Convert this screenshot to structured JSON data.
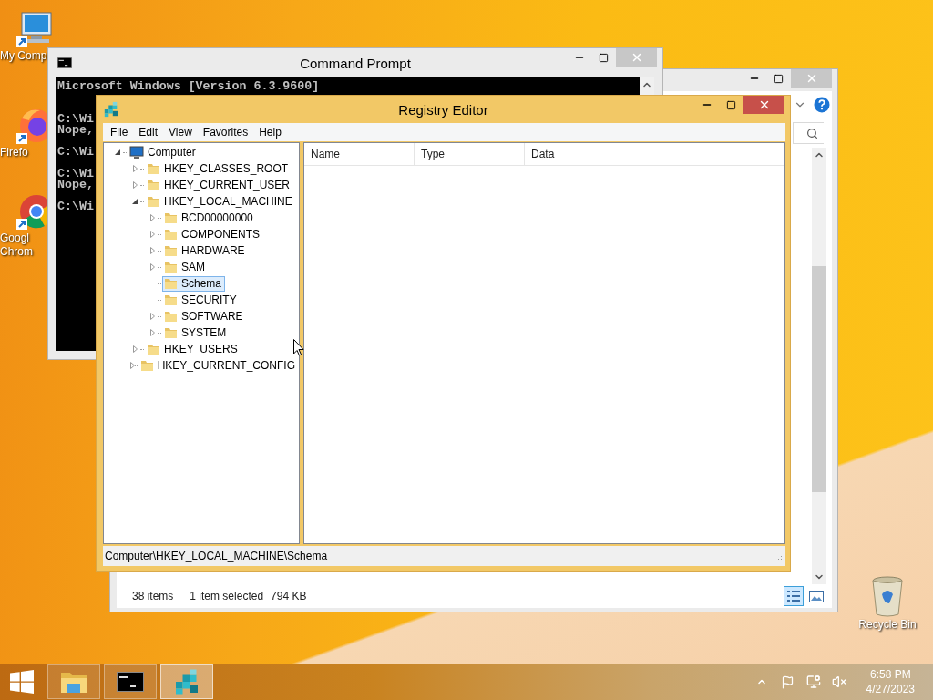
{
  "desktop": {
    "icons": [
      {
        "kind": "computer",
        "lines": [
          "My Comp"
        ]
      },
      {
        "kind": "firefox",
        "lines": [
          "Firefo"
        ]
      },
      {
        "kind": "chrome",
        "lines": [
          "Googl",
          "Chrom"
        ]
      },
      {
        "kind": "recycle",
        "lines": [
          "Recycle Bin"
        ]
      }
    ]
  },
  "command_prompt": {
    "title": "Command Prompt",
    "blocks": [
      [
        "Microsoft Windows [Version 6.3.9600]"
      ],
      [
        "C:\\Wi",
        "Nope,"
      ],
      [
        "C:\\Wi"
      ],
      [
        "C:\\Wi",
        "Nope,"
      ],
      [
        "C:\\Wi"
      ]
    ]
  },
  "explorer": {
    "status_bar": {
      "items": "38 items",
      "selection": "1 item selected",
      "size": "794 KB"
    },
    "views": [
      {
        "kind": "details",
        "selected": true
      },
      {
        "kind": "large",
        "selected": false
      }
    ]
  },
  "registry_editor": {
    "title": "Registry Editor",
    "menu": [
      "File",
      "Edit",
      "View",
      "Favorites",
      "Help"
    ],
    "tree": {
      "label": "Computer",
      "kind": "computer",
      "expanded": true,
      "selected": false,
      "children": [
        {
          "label": "HKEY_CLASSES_ROOT",
          "expanded": false,
          "selected": false
        },
        {
          "label": "HKEY_CURRENT_USER",
          "expanded": false,
          "selected": false
        },
        {
          "label": "HKEY_LOCAL_MACHINE",
          "expanded": true,
          "selected": false,
          "children": [
            {
              "label": "BCD00000000",
              "expanded": false,
              "selected": false
            },
            {
              "label": "COMPONENTS",
              "expanded": false,
              "selected": false
            },
            {
              "label": "HARDWARE",
              "expanded": false,
              "selected": false
            },
            {
              "label": "SAM",
              "expanded": false,
              "selected": false
            },
            {
              "label": "Schema",
              "selected": true
            },
            {
              "label": "SECURITY",
              "selected": false
            },
            {
              "label": "SOFTWARE",
              "expanded": false,
              "selected": false
            },
            {
              "label": "SYSTEM",
              "expanded": false,
              "selected": false
            }
          ]
        },
        {
          "label": "HKEY_USERS",
          "expanded": false,
          "selected": false
        },
        {
          "label": "HKEY_CURRENT_CONFIG",
          "expanded": false,
          "selected": false
        }
      ]
    },
    "columns": [
      "Name",
      "Type",
      "Data"
    ],
    "status_bar": "Computer\\HKEY_LOCAL_MACHINE\\Schema"
  },
  "taskbar": {
    "apps": [
      {
        "kind": "explorer",
        "selected": false
      },
      {
        "kind": "console",
        "selected": false
      },
      {
        "kind": "registry",
        "selected": true
      }
    ],
    "volume_muted": true,
    "time": "6:58 PM",
    "date": "4/27/2023"
  }
}
